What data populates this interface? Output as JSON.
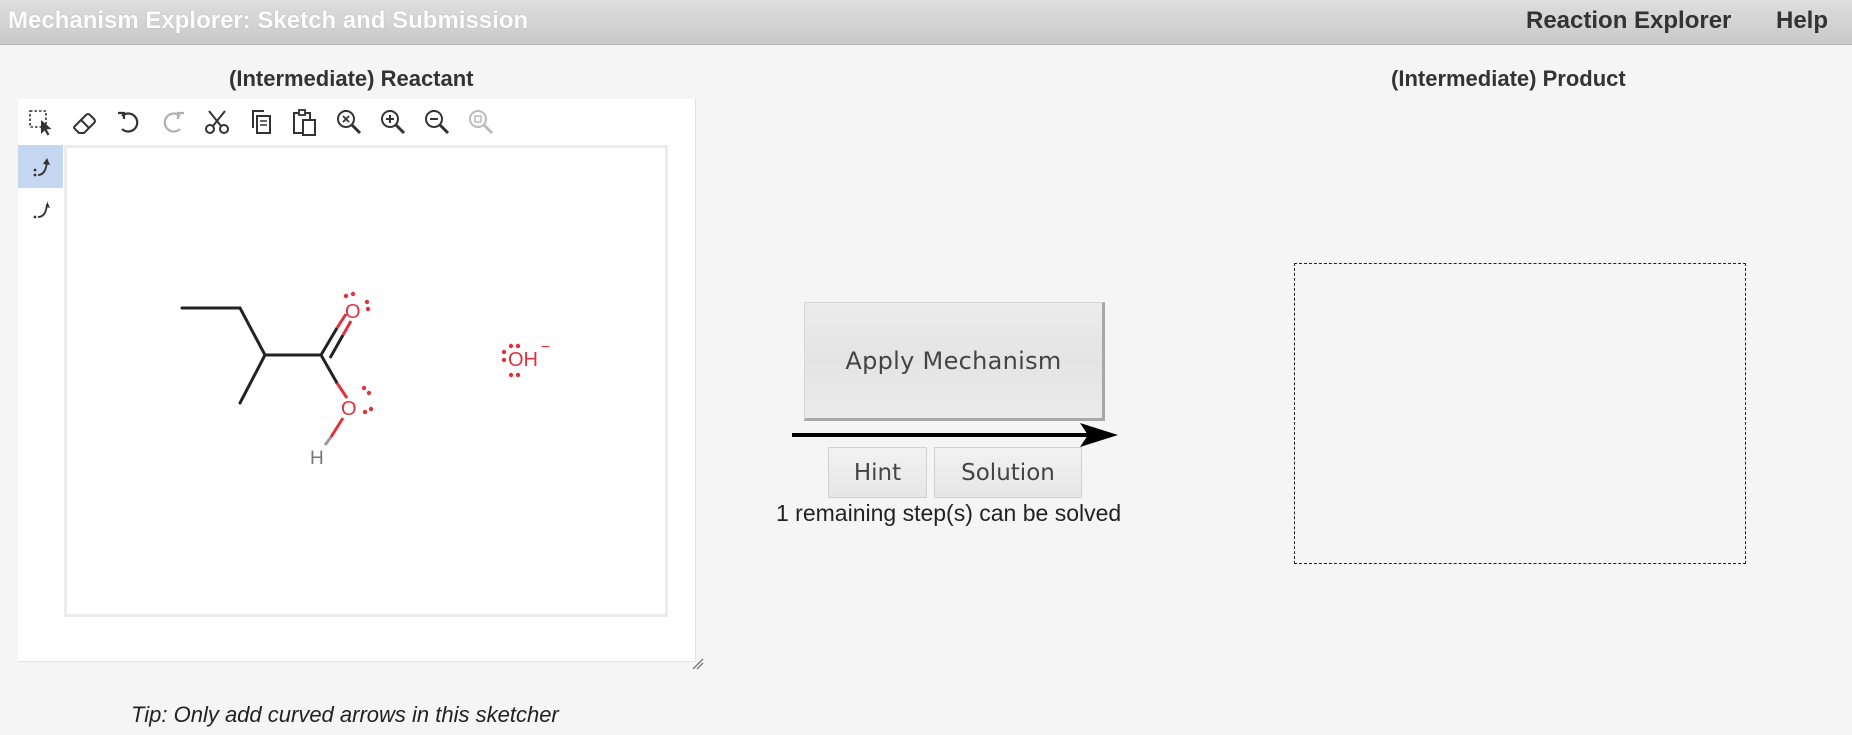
{
  "header": {
    "app_title": "Mechanism Explorer: Sketch and Submission",
    "nav": [
      {
        "label": "Reaction Explorer"
      },
      {
        "label": "Help"
      }
    ]
  },
  "reactant_panel": {
    "title": "(Intermediate) Reactant",
    "toolbar_icons": [
      "select-icon",
      "eraser-icon",
      "undo-icon",
      "redo-icon",
      "cut-icon",
      "copy-icon",
      "paste-icon",
      "zoom-fit-icon",
      "zoom-in-icon",
      "zoom-out-icon",
      "zoom-reset-icon"
    ],
    "side_tools": [
      {
        "icon": "curved-arrow-electron-pair-icon",
        "active": true
      },
      {
        "icon": "curved-arrow-single-electron-icon",
        "active": false
      }
    ],
    "molecule": {
      "atom_labels": [
        "O",
        "O",
        "H"
      ],
      "ion_label": "OH",
      "ion_charge": "−"
    },
    "tip": "Tip: Only add curved arrows in this sketcher"
  },
  "middle": {
    "apply_label": "Apply Mechanism",
    "hint_label": "Hint",
    "solution_label": "Solution",
    "remaining_text": "1 remaining step(s) can be solved"
  },
  "product_panel": {
    "title": "(Intermediate) Product"
  },
  "colors": {
    "heteroatom": "#e0323c",
    "bond": "#222222",
    "active_tool": "#c5d6f0"
  }
}
